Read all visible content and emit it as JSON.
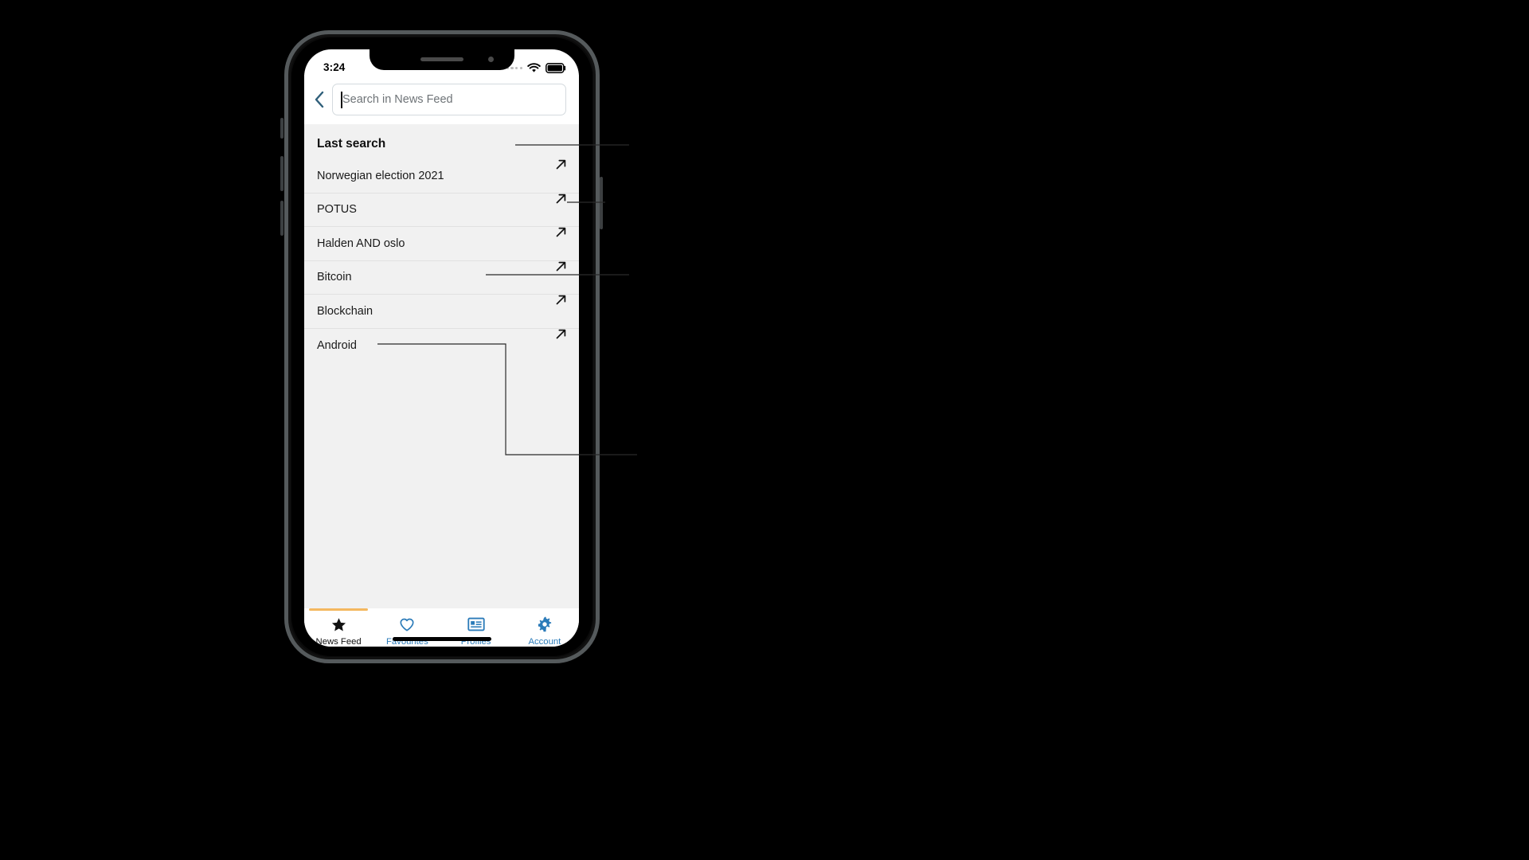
{
  "device": {
    "name": "smartphone-mockup",
    "home_indicator": "home-indicator"
  },
  "status_bar": {
    "time": "3:24",
    "signal_icon": "signal-dots-icon",
    "wifi_icon": "wifi-icon",
    "battery_icon": "battery-full-icon"
  },
  "search": {
    "back_icon": "chevron-left-icon",
    "placeholder": "Search in News Feed",
    "value": ""
  },
  "list": {
    "header": "Last search",
    "arrow_icon": "arrow-up-right-icon",
    "items": [
      {
        "label": "Norwegian election 2021"
      },
      {
        "label": "POTUS"
      },
      {
        "label": "Halden AND oslo"
      },
      {
        "label": "Bitcoin"
      },
      {
        "label": "Blockchain"
      },
      {
        "label": "Android"
      }
    ]
  },
  "tabbar": {
    "tabs": [
      {
        "label": "News Feed",
        "icon": "star-icon",
        "active": true
      },
      {
        "label": "Favourites",
        "icon": "heart-icon",
        "active": false
      },
      {
        "label": "Profiles",
        "icon": "card-icon",
        "active": false
      },
      {
        "label": "Account",
        "icon": "gear-icon",
        "active": false
      }
    ]
  },
  "colors": {
    "accent_active": "#f4b860",
    "link_blue": "#2b7bb9",
    "back_chevron": "#2f5f7a",
    "list_bg": "#f1f1f1",
    "divider": "#e1e1e1"
  }
}
